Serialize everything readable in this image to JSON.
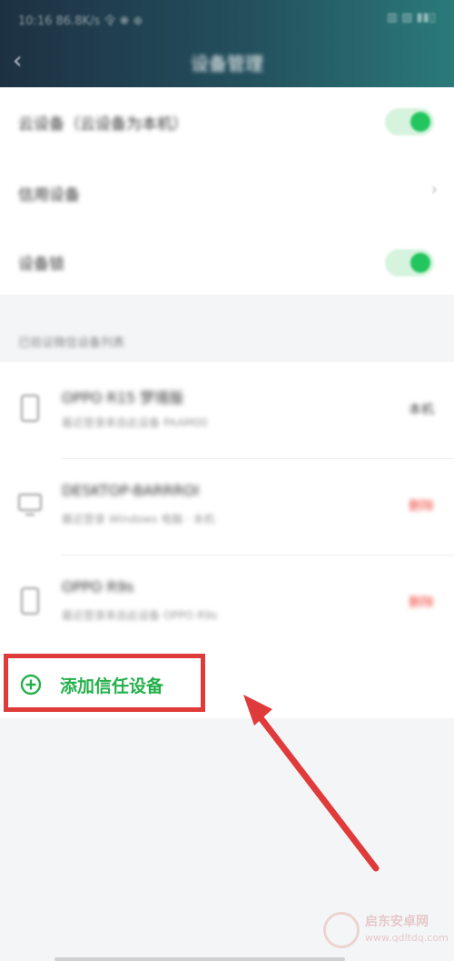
{
  "status_bar": {
    "left": "10:16 86.8K/s 令 ❋ ⊕",
    "right": "▥ ▨ ▮▮▯"
  },
  "header": {
    "title": "设备管理",
    "back_icon": "back-chevron-icon"
  },
  "settings": [
    {
      "label": "云设备（云设备为本机）",
      "control": "toggle",
      "on": true
    },
    {
      "label": "信用设备",
      "control": "chevron"
    },
    {
      "label": "设备锁",
      "control": "toggle",
      "on": true
    }
  ],
  "section_label": "已验证微信设备列表",
  "devices": [
    {
      "name": "OPPO R15 梦境版",
      "desc": "最近登录来自此设备 PAAM00",
      "status": "本机",
      "status_color": "#444444",
      "icon": "phone-icon"
    },
    {
      "name": "DESKTOP-BARRROI",
      "desc": "最近登录 Windows 电脑 · 本机",
      "status": "删除",
      "status_color": "#f04a3e",
      "icon": "monitor-icon"
    },
    {
      "name": "OPPO R9s",
      "desc": "最近登录来自此设备 OPPO R9s",
      "status": "删除",
      "status_color": "#f04a3e",
      "icon": "phone-icon"
    }
  ],
  "add_trusted": {
    "label": "添加信任设备",
    "icon": "plus-circle-icon"
  },
  "watermark": {
    "name": "启东安卓网",
    "url": "www.qdltdq.com"
  },
  "colors": {
    "accent_green": "#23b04a",
    "annotation_red": "#e03b3b"
  }
}
